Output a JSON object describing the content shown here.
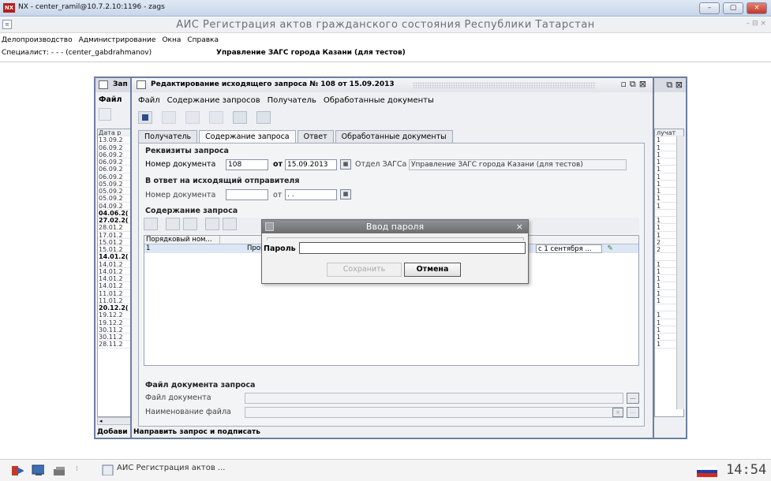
{
  "nx": {
    "title": "NX - center_ramil@10.7.2.10:1196 - zags",
    "logo": "NX"
  },
  "app": {
    "title": "АИС Регистрация актов гражданского состояния Республики Татарстан",
    "controls": "– ⊟ ×"
  },
  "main_menu": [
    "Делопроизводство",
    "Администрирование",
    "Окна",
    "Справка"
  ],
  "specialist": {
    "label": "Специалист: - - - (center_gabdrahmanov)",
    "dept": "Управление ЗАГС города Казани (для тестов)"
  },
  "bg_window": {
    "title": "Зап",
    "menu": [
      "Файл"
    ],
    "date_header": "Дата р",
    "dates": [
      "13.09.2",
      "06.09.2",
      "06.09.2",
      "06.09.2",
      "06.09.2",
      "06.09.2",
      "05.09.2",
      "05.09.2",
      "05.09.2",
      "04.09.2",
      "04.06.2(",
      "27.02.2(",
      "28.01.2",
      "17.01.2",
      "15.01.2",
      "15.01.2",
      "14.01.2(",
      "14.01.2",
      "14.01.2",
      "14.01.2",
      "14.01.2",
      "11.01.2",
      "11.01.2",
      "20.12.2(",
      "19.12.2",
      "19.12.2",
      "30.11.2",
      "30.11.2",
      "28.11.2"
    ],
    "bold_dates": [
      10,
      11,
      16,
      23
    ],
    "right_header": "лучат",
    "right_vals": [
      "1",
      "1",
      "1",
      "1",
      "1",
      "1",
      "1",
      "1",
      "1",
      "1",
      "",
      "1",
      "1",
      "1",
      "2",
      "2",
      "",
      "1",
      "1",
      "1",
      "1",
      "1",
      "1",
      "",
      "1",
      "1",
      "1",
      "1",
      "1"
    ],
    "bottom_text": "Добави"
  },
  "edit_window": {
    "title": "Редактирование исходящего запроса № 108 от 15.09.2013",
    "menu": [
      "Файл",
      "Содержание запросов",
      "Получатель",
      "Обработанные документы"
    ],
    "tabs": [
      "Получатель",
      "Содержание запроса",
      "Ответ",
      "Обработанные документы"
    ],
    "active_tab": 1,
    "requisites": {
      "title": "Реквизиты запроса",
      "doc_number_label": "Номер документа",
      "doc_number": "108",
      "from_label": "от",
      "date": "15.09.2013",
      "dept_label": "Отдел ЗАГСа",
      "dept": "Управление ЗАГС города Казани (для тестов)"
    },
    "reply": {
      "title": "В ответ на исходящий отправителя",
      "doc_number_label": "Номер документа",
      "from_label": "от",
      "date": " .  . "
    },
    "content": {
      "title": "Содержание запроса",
      "columns": [
        "Порядковый ном...",
        ""
      ],
      "row": {
        "num": "1",
        "text": "Прошу п",
        "tail": "с 1 сентября ..."
      }
    },
    "file": {
      "title": "Файл документа запроса",
      "file_label": "Файл документа",
      "name_label": "Наименование файла",
      "browse": "...",
      "clear": "×"
    },
    "bottom_text": "Направить запрос и подписать"
  },
  "dialog": {
    "title": "Ввод пароля",
    "password_label": "Пароль",
    "save": "Сохранить",
    "cancel": "Отмена"
  },
  "taskbar": {
    "app": "АИС Регистрация актов ...",
    "clock": "14:54"
  },
  "colors": {
    "window_border": "#6d7fa0",
    "dialog_title": "#6d6e72",
    "nx_close": "#c0392b"
  }
}
